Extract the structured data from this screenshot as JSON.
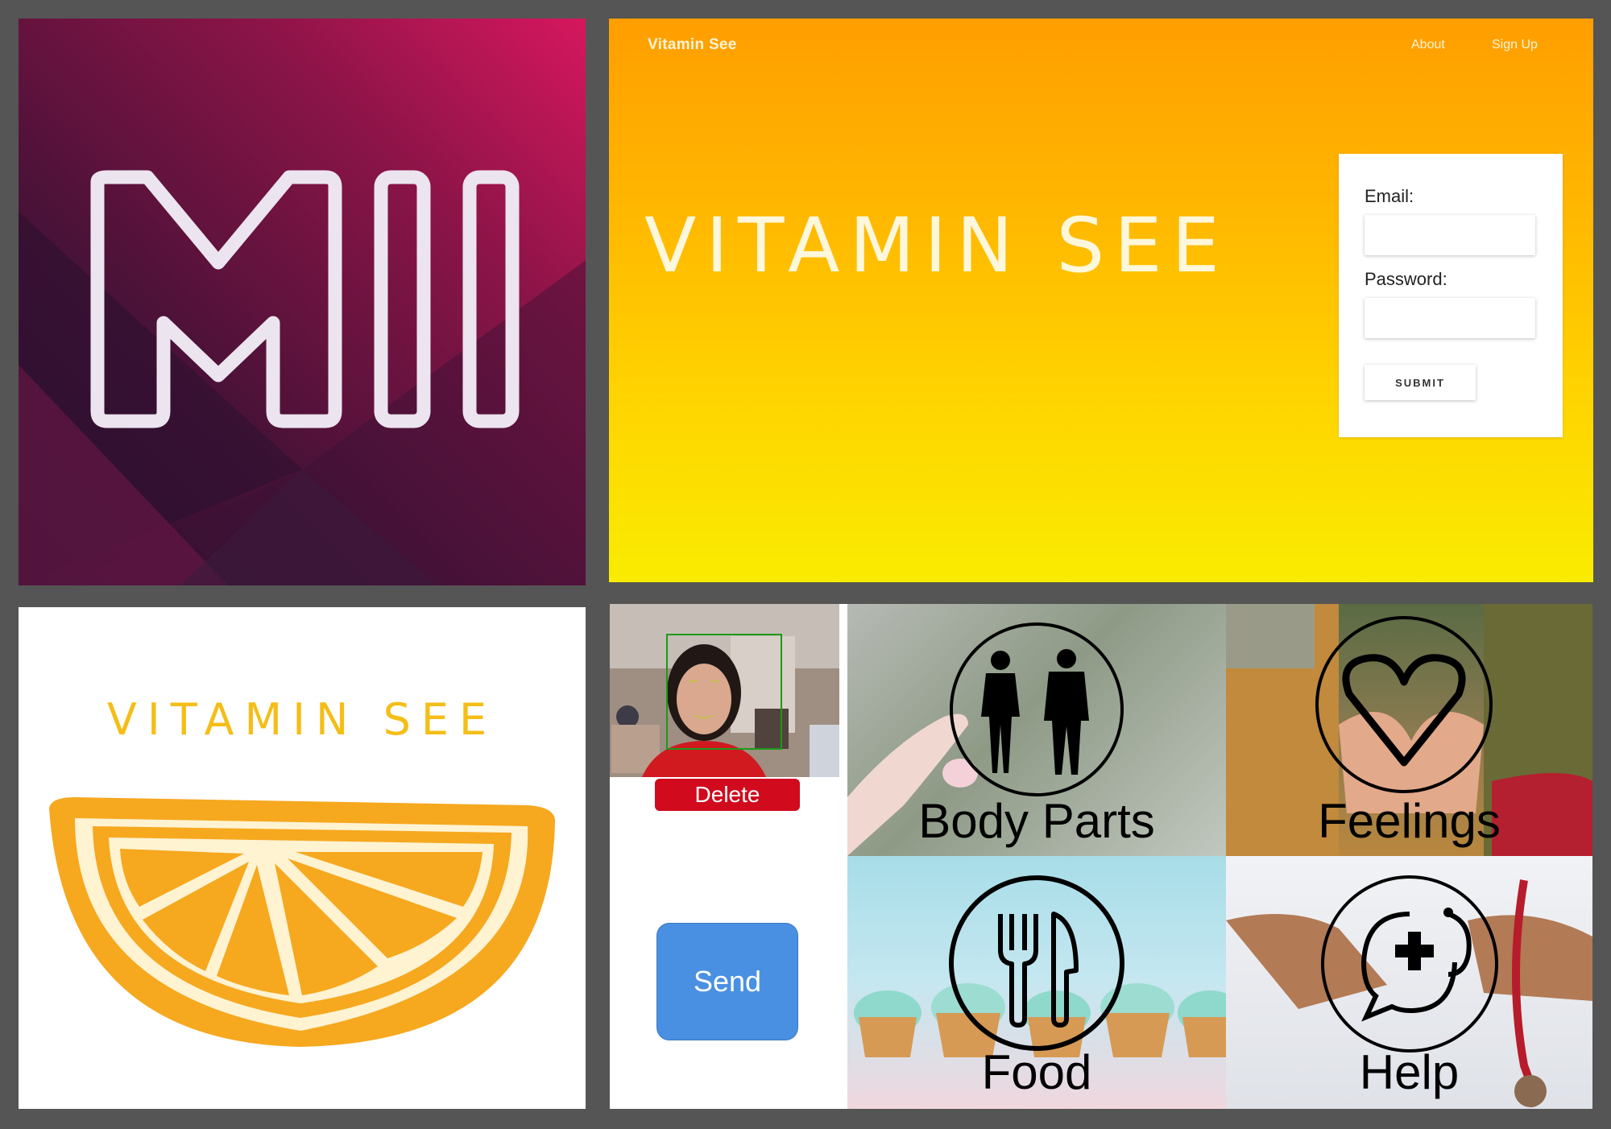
{
  "landing": {
    "brand": "Vitamin See",
    "nav": [
      "About",
      "Sign Up"
    ],
    "hero_title": "VITAMIN SEE",
    "login": {
      "email_label": "Email:",
      "password_label": "Password:",
      "submit_label": "SUBMIT"
    }
  },
  "logo_panel": {
    "brand_color": "#f4be18",
    "title": "VITAMIN SEE"
  },
  "app": {
    "delete_label": "Delete",
    "send_label": "Send",
    "categories": [
      {
        "label": "Body Parts",
        "icon": "body-figures-icon"
      },
      {
        "label": "Feelings",
        "icon": "heart-icon"
      },
      {
        "label": "Food",
        "icon": "fork-knife-icon"
      },
      {
        "label": "Help",
        "icon": "medical-chat-icon"
      }
    ],
    "colors": {
      "delete": "#d10a1e",
      "send": "#4a90e2"
    }
  }
}
